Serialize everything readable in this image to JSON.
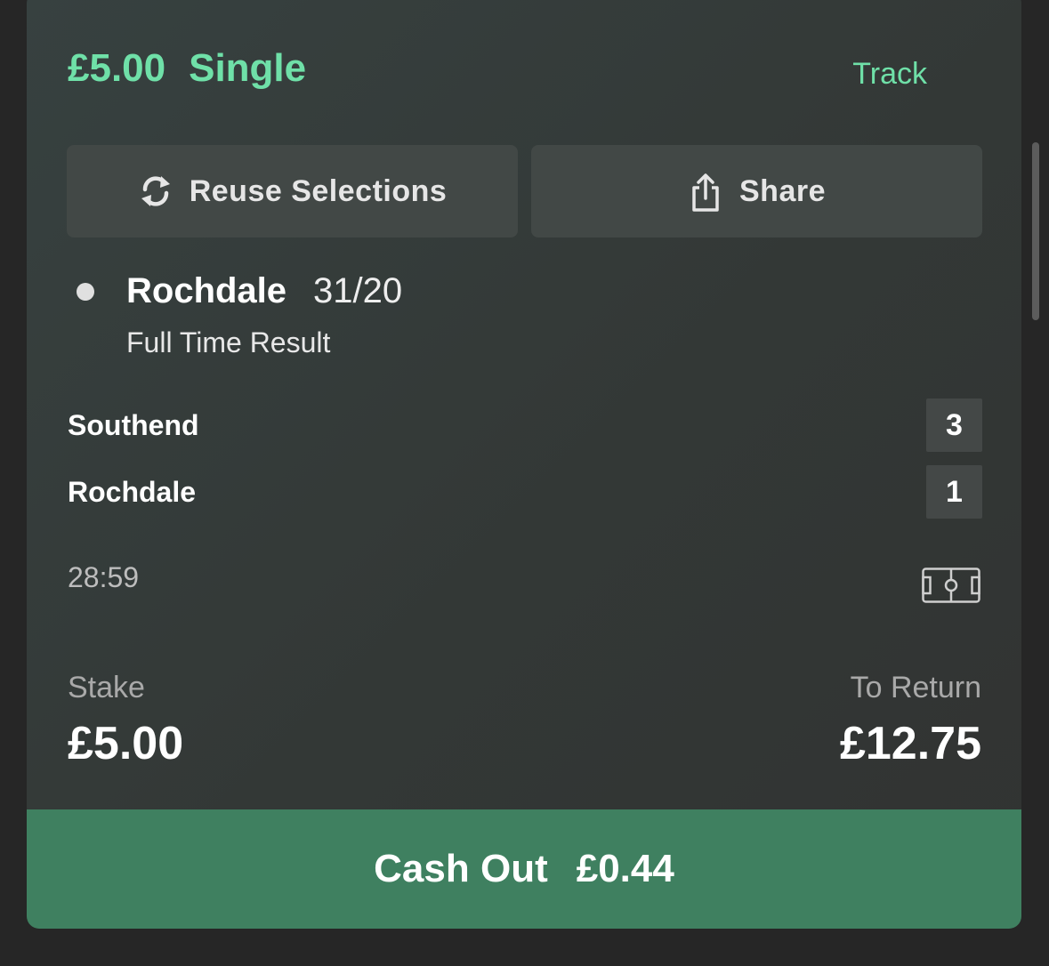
{
  "bet": {
    "amount": "£5.00",
    "type": "Single",
    "track_label": "Track"
  },
  "actions": {
    "reuse_label": "Reuse Selections",
    "share_label": "Share"
  },
  "selection": {
    "name": "Rochdale",
    "odds": "31/20",
    "market": "Full Time Result"
  },
  "match": {
    "teams": [
      {
        "name": "Southend",
        "score": "3"
      },
      {
        "name": "Rochdale",
        "score": "1"
      }
    ],
    "clock": "28:59"
  },
  "summary": {
    "stake_label": "Stake",
    "stake_value": "£5.00",
    "return_label": "To Return",
    "return_value": "£12.75"
  },
  "cashout": {
    "label": "Cash Out",
    "amount": "£0.44"
  },
  "icons": {
    "reuse": "refresh-icon",
    "share": "share-icon",
    "pitch": "football-pitch-icon"
  },
  "colors": {
    "accent": "#6fe0a8",
    "cashout": "#3f8060"
  }
}
